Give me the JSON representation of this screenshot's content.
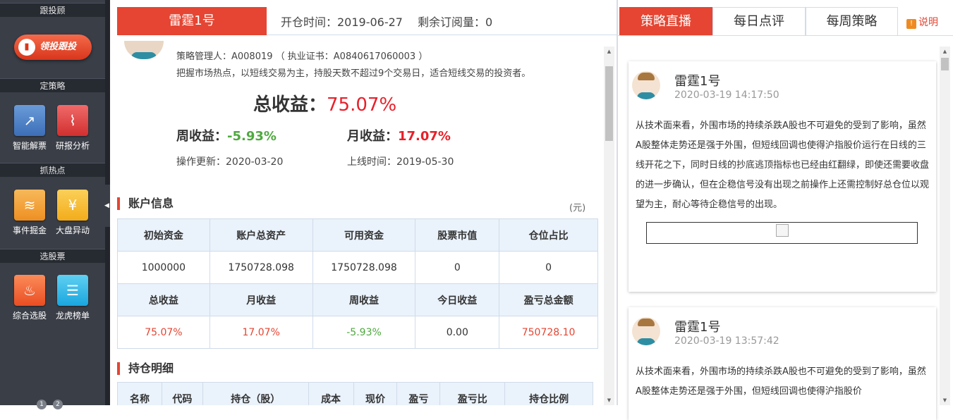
{
  "sidebar": {
    "sections": [
      "跟投顾",
      "定策略",
      "抓热点",
      "选股票"
    ],
    "brand_button": "领投跟投",
    "tools": [
      {
        "label": "智能解票",
        "icon": "chart-trend-icon"
      },
      {
        "label": "研报分析",
        "icon": "analysis-chart-icon"
      },
      {
        "label": "事件掘金",
        "icon": "layers-icon"
      },
      {
        "label": "大盘异动",
        "icon": "yuan-search-icon"
      },
      {
        "label": "综合选股",
        "icon": "flame-icon"
      },
      {
        "label": "龙虎榜单",
        "icon": "document-icon"
      }
    ],
    "pages": [
      "1",
      "2"
    ],
    "colors": {
      "bg": "#3a3e47",
      "accent": "#e54532"
    }
  },
  "strategy": {
    "tab_name": "雷霆1号",
    "open_date": "开仓时间：2019-06-27",
    "remaining": "剩余订阅量：0",
    "manager": "策略管理人：A008019 （ 执业证书：A0840617060003 ）",
    "description": "把握市场热点，以短线交易为主，持股天数不超过9个交易日，适合短线交易的投资者。",
    "total_label": "总收益：",
    "total_value": "75.07%",
    "week_label": "周收益：",
    "week_value": "-5.93%",
    "month_label": "月收益：",
    "month_value": "17.07%",
    "update": "操作更新：2020-03-20",
    "online": "上线时间：2019-05-30"
  },
  "account": {
    "title": "账户信息",
    "unit": "(元)",
    "headers1": [
      "初始资金",
      "账户总资产",
      "可用资金",
      "股票市值",
      "仓位占比"
    ],
    "row1": [
      "1000000",
      "1750728.098",
      "1750728.098",
      "0",
      "0"
    ],
    "headers2": [
      "总收益",
      "月收益",
      "周收益",
      "今日收益",
      "盈亏总金额"
    ],
    "row2": [
      "75.07%",
      "17.07%",
      "-5.93%",
      "0.00",
      "750728.10"
    ]
  },
  "holdings": {
    "title": "持仓明细",
    "headers": [
      "名称",
      "代码",
      "持仓（股）",
      "成本",
      "现价",
      "盈亏",
      "盈亏比",
      "持仓比例"
    ]
  },
  "right": {
    "tabs": [
      "策略直播",
      "每日点评",
      "每周策略"
    ],
    "help": "说明",
    "posts": [
      {
        "name": "雷霆1号",
        "time": "2020-03-19 14:17:50",
        "text": "从技术面来看，外围市场的持续杀跌A股也不可避免的受到了影响，虽然A股整体走势还是强于外围，但短线回调也使得沪指股价运行在日线的三线开花之下，同时日线的抄底逃顶指标也已经由红翻绿，即使还需要收盘的进一步确认，但在企稳信号没有出现之前操作上还需控制好总仓位以观望为主，耐心等待企稳信号的出现。"
      },
      {
        "name": "雷霆1号",
        "time": "2020-03-19 13:57:42",
        "text": "从技术面来看，外围市场的持续杀跌A股也不可避免的受到了影响，虽然A股整体走势还是强于外围，但短线回调也使得沪指股价"
      }
    ]
  }
}
